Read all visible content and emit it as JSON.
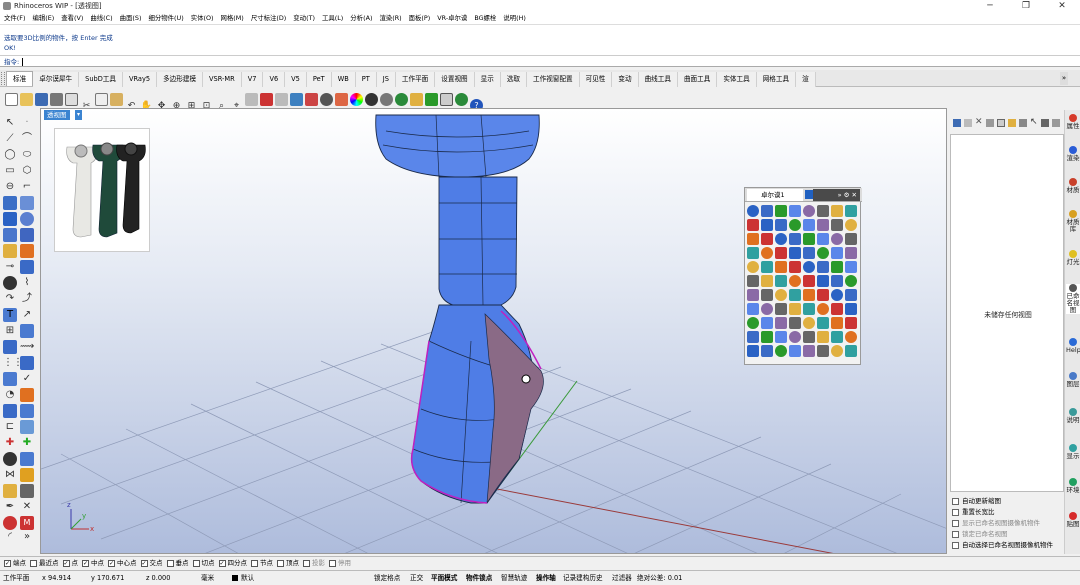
{
  "window": {
    "title": "Rhinoceros WIP - [透视图]",
    "min": "─",
    "max": "❐",
    "close": "✕"
  },
  "menu": [
    "文件(F)",
    "编辑(E)",
    "查看(V)",
    "曲线(C)",
    "曲面(S)",
    "细分物件(U)",
    "实体(O)",
    "网格(M)",
    "尺寸标注(D)",
    "变动(T)",
    "工具(L)",
    "分析(A)",
    "渲染(R)",
    "面板(P)",
    "VR-卓尔谟",
    "BG螺栓",
    "说明(H)"
  ],
  "history": {
    "line1": "选取要3D比例的物件，按 Enter 完成",
    "line2": "OK!"
  },
  "command": {
    "label": "指令:"
  },
  "tabs": [
    "标准",
    "卓尔谟犀牛",
    "SubD工具",
    "VRay5",
    "多边形建模",
    "VSR-MR",
    "V7",
    "V6",
    "V5",
    "PeT",
    "WB",
    "PT",
    "JS",
    "工作平面",
    "设置视图",
    "显示",
    "选取",
    "工作视窗配置",
    "可见性",
    "变动",
    "曲线工具",
    "曲面工具",
    "实体工具",
    "网格工具",
    "渲"
  ],
  "viewport": {
    "label": "透视图",
    "arrow": "▾"
  },
  "floatpanel": {
    "tab": "卓尔谟1",
    "more": "»",
    "gear": "⚙",
    "close": "✕"
  },
  "rightpanel": {
    "empty_text": "未储存任何视图",
    "options": [
      {
        "label": "自动更新缩图",
        "enabled": true
      },
      {
        "label": "重置长宽比",
        "enabled": true
      },
      {
        "label": "显示已命名视图摄像机物件",
        "enabled": false
      },
      {
        "label": "锁定已命名视图",
        "enabled": false
      },
      {
        "label": "自动选择已命名视图摄像机物件",
        "enabled": true
      }
    ]
  },
  "sidetabs": [
    {
      "label": "属性",
      "color": "#d63a2a"
    },
    {
      "label": "渲染",
      "color": "#2a5cd6"
    },
    {
      "label": "材质",
      "color": "#c8402a"
    },
    {
      "label": "材质库",
      "color": "#d8a020"
    },
    {
      "label": "灯光",
      "color": "#e0c020"
    },
    {
      "label": "已命名视图",
      "color": "#555555"
    },
    {
      "label": "Help",
      "color": "#2a6ad6"
    },
    {
      "label": "图层",
      "color": "#4a7ac8"
    },
    {
      "label": "说明",
      "color": "#3a9a9a"
    },
    {
      "label": "显示",
      "color": "#30a0a0"
    },
    {
      "label": "环境",
      "color": "#20a060"
    },
    {
      "label": "贴图",
      "color": "#d62a2a"
    }
  ],
  "osnaps": [
    {
      "label": "端点",
      "checked": true
    },
    {
      "label": "最近点",
      "checked": false
    },
    {
      "label": "点",
      "checked": true
    },
    {
      "label": "中点",
      "checked": true
    },
    {
      "label": "中心点",
      "checked": true
    },
    {
      "label": "交点",
      "checked": true
    },
    {
      "label": "垂点",
      "checked": false
    },
    {
      "label": "切点",
      "checked": false
    },
    {
      "label": "四分点",
      "checked": true
    },
    {
      "label": "节点",
      "checked": false
    },
    {
      "label": "顶点",
      "checked": false
    },
    {
      "label": "投影",
      "checked": false,
      "dim": true
    },
    {
      "label": "停用",
      "checked": false,
      "dim": true
    }
  ],
  "status": {
    "cplane": "工作平面",
    "x": "x 94.914",
    "y": "y 170.671",
    "z": "z 0.000",
    "unit": "毫米",
    "layer": "默认",
    "grid_snap": "锁定格点",
    "ortho": "正交",
    "planar": "平面模式",
    "osnap": "物件锁点",
    "smart_track": "智慧轨迹",
    "gumball": "操作轴",
    "history": "记录建构历史",
    "filter": "过滤器",
    "tolerance": "绝对公差: 0.01"
  },
  "axis": {
    "x": "x",
    "y": "y",
    "z": "z"
  }
}
